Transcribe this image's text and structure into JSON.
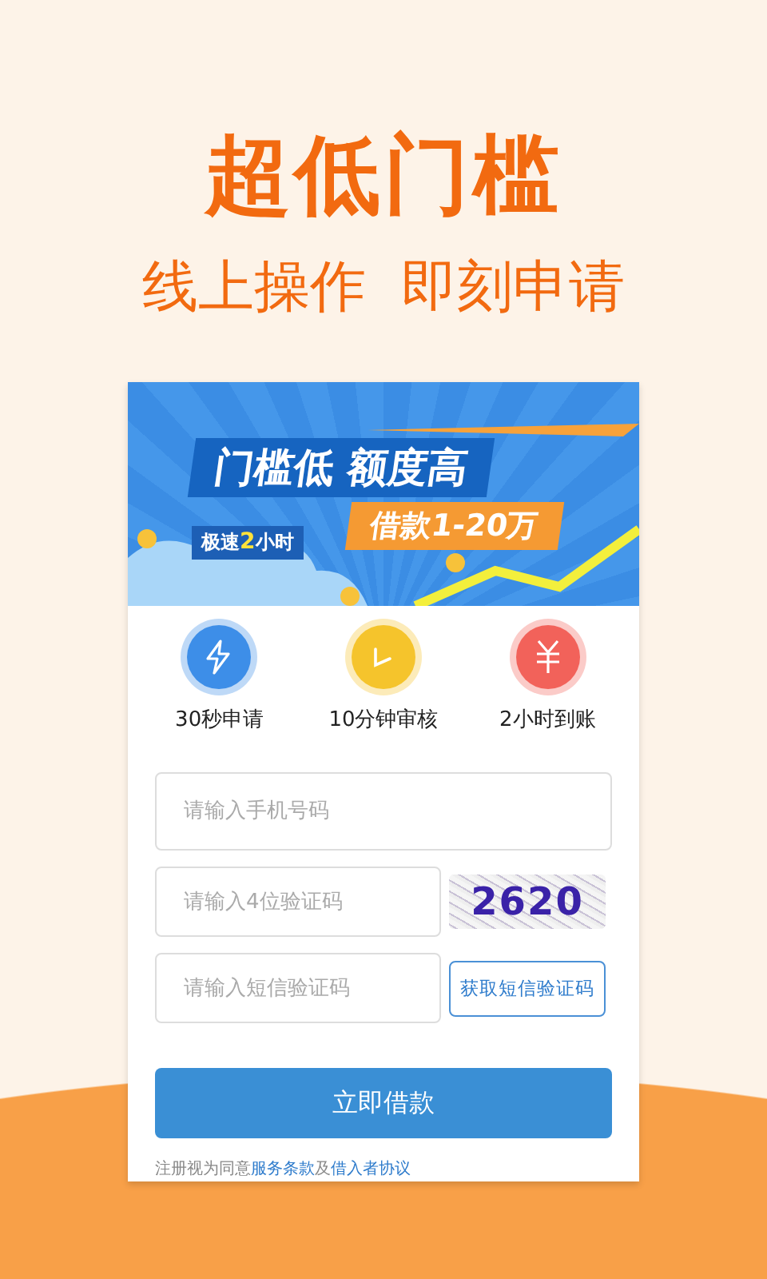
{
  "headline": "超低门槛",
  "subheadline": "线上操作  即刻申请",
  "banner": {
    "title": "门槛低 额度高",
    "amount": "借款1-20万",
    "speed_tag": "极速**2**小时"
  },
  "features": [
    {
      "kind": "bolt",
      "color": "#3d8ee8",
      "label": "30秒申请"
    },
    {
      "kind": "clock",
      "color": "#f5c42c",
      "label": "10分钟审核"
    },
    {
      "kind": "yen",
      "color": "#f2625a",
      "label": "2小时到账"
    }
  ],
  "form": {
    "phone": {
      "placeholder": "请输入手机号码"
    },
    "captcha_field": {
      "placeholder": "请输入4位验证码"
    },
    "captcha_image": "2620",
    "sms_field": {
      "placeholder": "请输入短信验证码"
    },
    "sms_button": "获取短信验证码",
    "submit": "立即借款"
  },
  "terms": {
    "prefix": "注册视为同意",
    "link_1": "服务条款",
    "joiner": "及",
    "link_2": "借入者协议"
  }
}
